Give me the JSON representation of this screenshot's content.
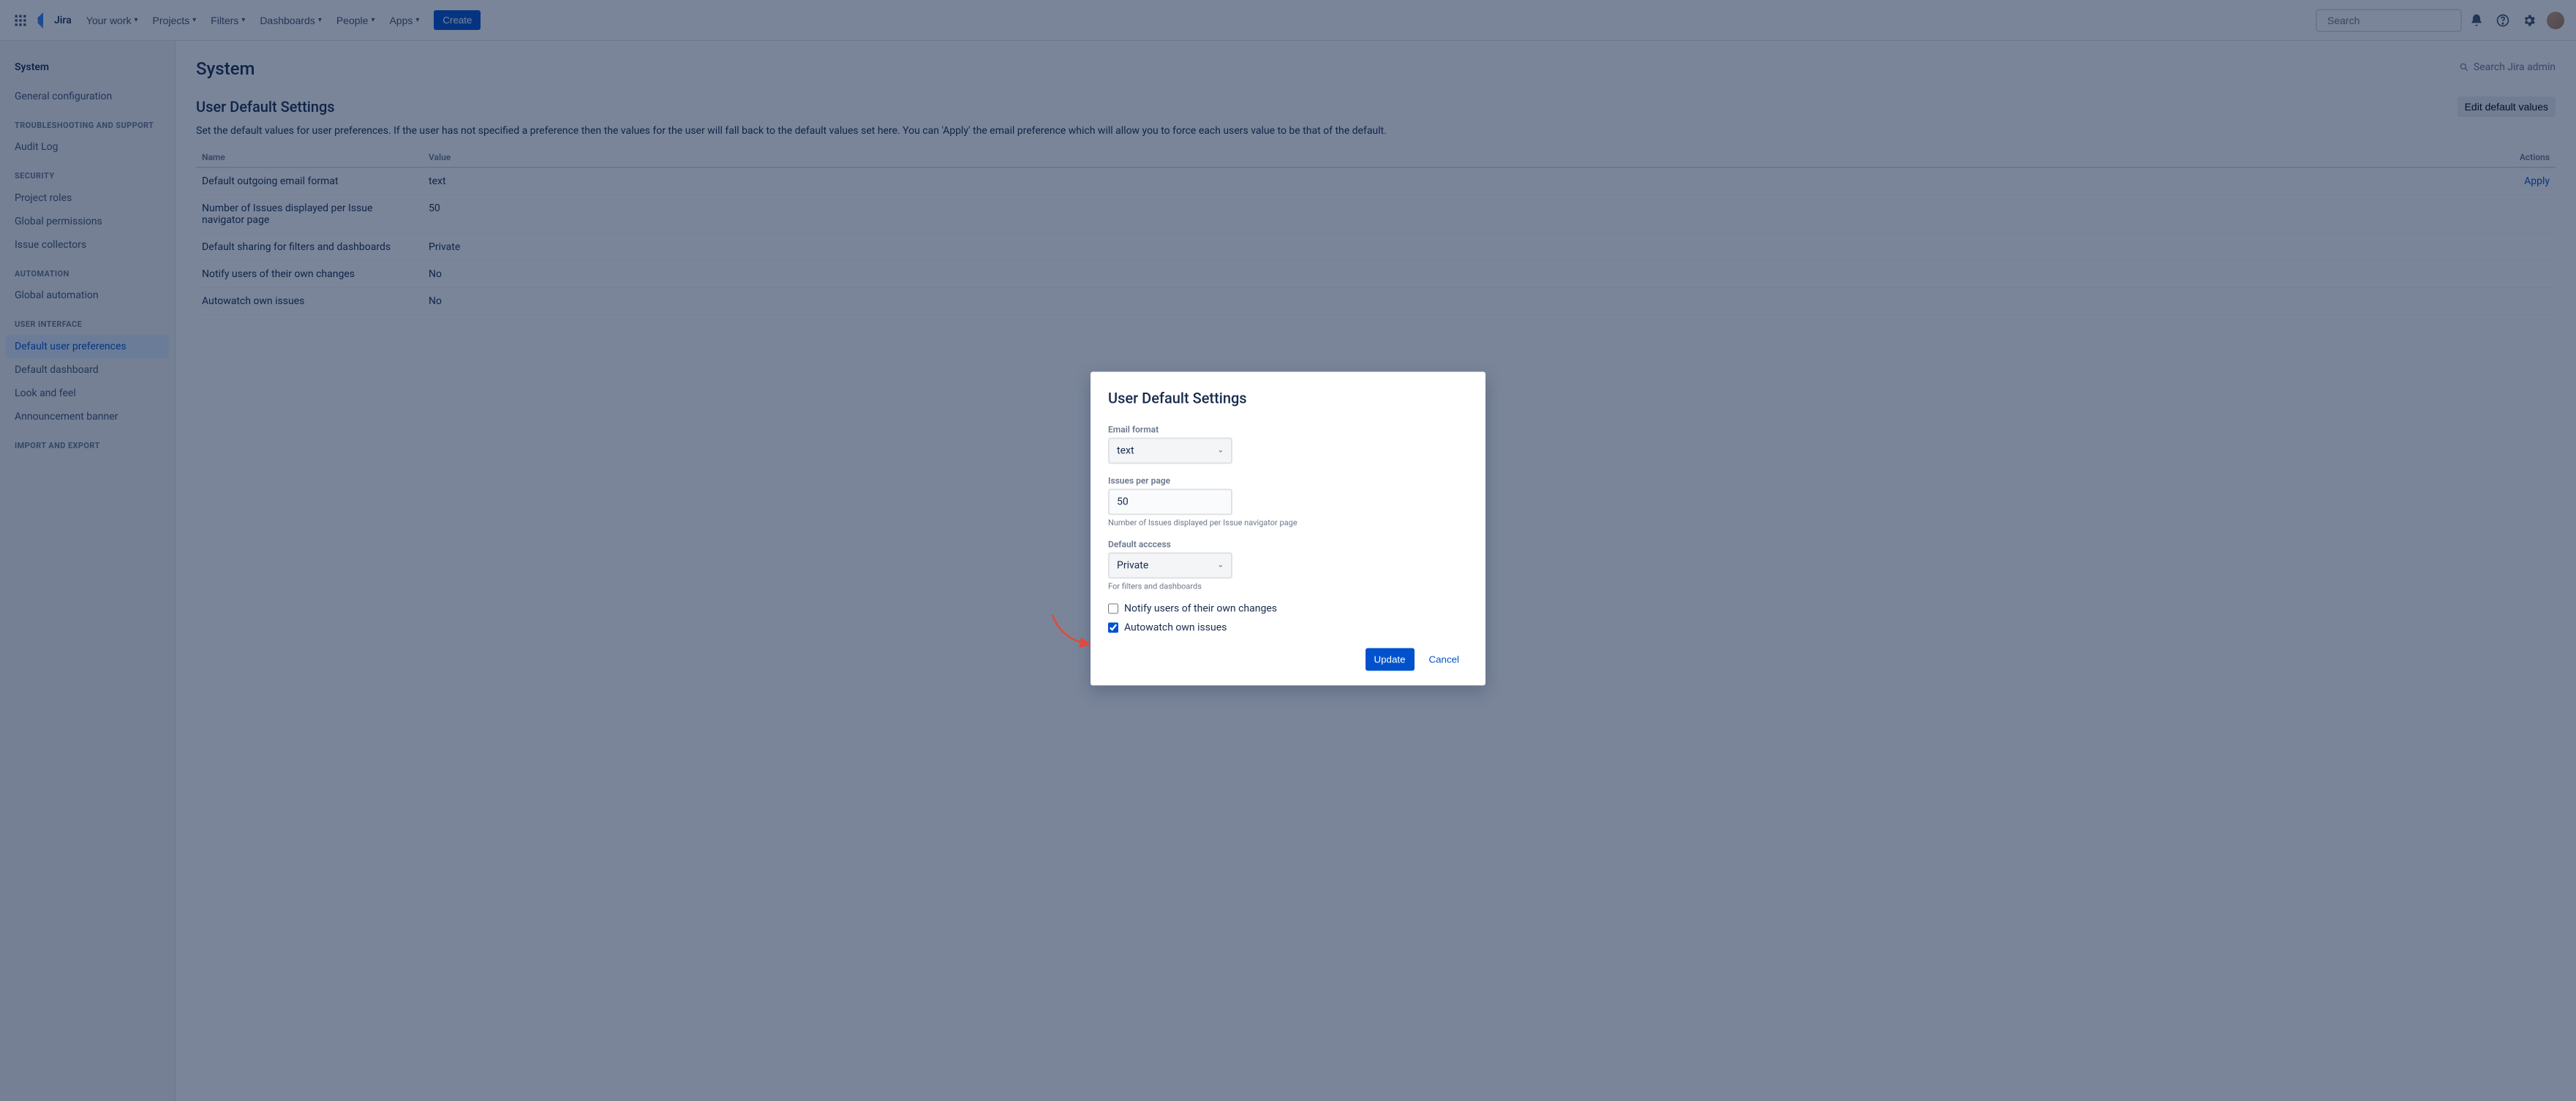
{
  "nav": {
    "product": "Jira",
    "items": [
      "Your work",
      "Projects",
      "Filters",
      "Dashboards",
      "People",
      "Apps"
    ],
    "create": "Create",
    "search_placeholder": "Search"
  },
  "sidebar": {
    "title": "System",
    "groups": [
      {
        "title": null,
        "items": [
          {
            "label": "General configuration",
            "selected": false
          }
        ]
      },
      {
        "title": "Troubleshooting and support",
        "items": [
          {
            "label": "Audit Log",
            "selected": false
          }
        ]
      },
      {
        "title": "Security",
        "items": [
          {
            "label": "Project roles",
            "selected": false
          },
          {
            "label": "Global permissions",
            "selected": false
          },
          {
            "label": "Issue collectors",
            "selected": false
          }
        ]
      },
      {
        "title": "Automation",
        "items": [
          {
            "label": "Global automation",
            "selected": false
          }
        ]
      },
      {
        "title": "User interface",
        "items": [
          {
            "label": "Default user preferences",
            "selected": true
          },
          {
            "label": "Default dashboard",
            "selected": false
          },
          {
            "label": "Look and feel",
            "selected": false
          },
          {
            "label": "Announcement banner",
            "selected": false
          }
        ]
      },
      {
        "title": "Import and export",
        "items": []
      }
    ]
  },
  "main": {
    "breadcrumb": "System",
    "admin_search": "Search Jira admin",
    "title": "User Default Settings",
    "edit": "Edit default values",
    "desc": "Set the default values for user preferences. If the user has not specified a preference then the values for the user will fall back to the default values set here. You can 'Apply' the email preference which will allow you to force each users value to be that of the default.",
    "columns": {
      "name": "Name",
      "value": "Value",
      "actions": "Actions"
    },
    "rows": [
      {
        "name": "Default outgoing email format",
        "value": "text",
        "action": "Apply"
      },
      {
        "name": "Number of Issues displayed per Issue navigator page",
        "value": "50",
        "action": null
      },
      {
        "name": "Default sharing for filters and dashboards",
        "value": "Private",
        "action": null
      },
      {
        "name": "Notify users of their own changes",
        "value": "No",
        "action": null
      },
      {
        "name": "Autowatch own issues",
        "value": "No",
        "action": null
      }
    ]
  },
  "dialog": {
    "title": "User Default Settings",
    "email_format_label": "Email format",
    "email_format_value": "text",
    "issues_label": "Issues per page",
    "issues_value": "50",
    "issues_help": "Number of Issues displayed per Issue navigator page",
    "access_label": "Default acccess",
    "access_value": "Private",
    "access_help": "For filters and dashboards",
    "notify_label": "Notify users of their own changes",
    "notify_checked": false,
    "autowatch_label": "Autowatch own issues",
    "autowatch_checked": true,
    "update": "Update",
    "cancel": "Cancel"
  }
}
